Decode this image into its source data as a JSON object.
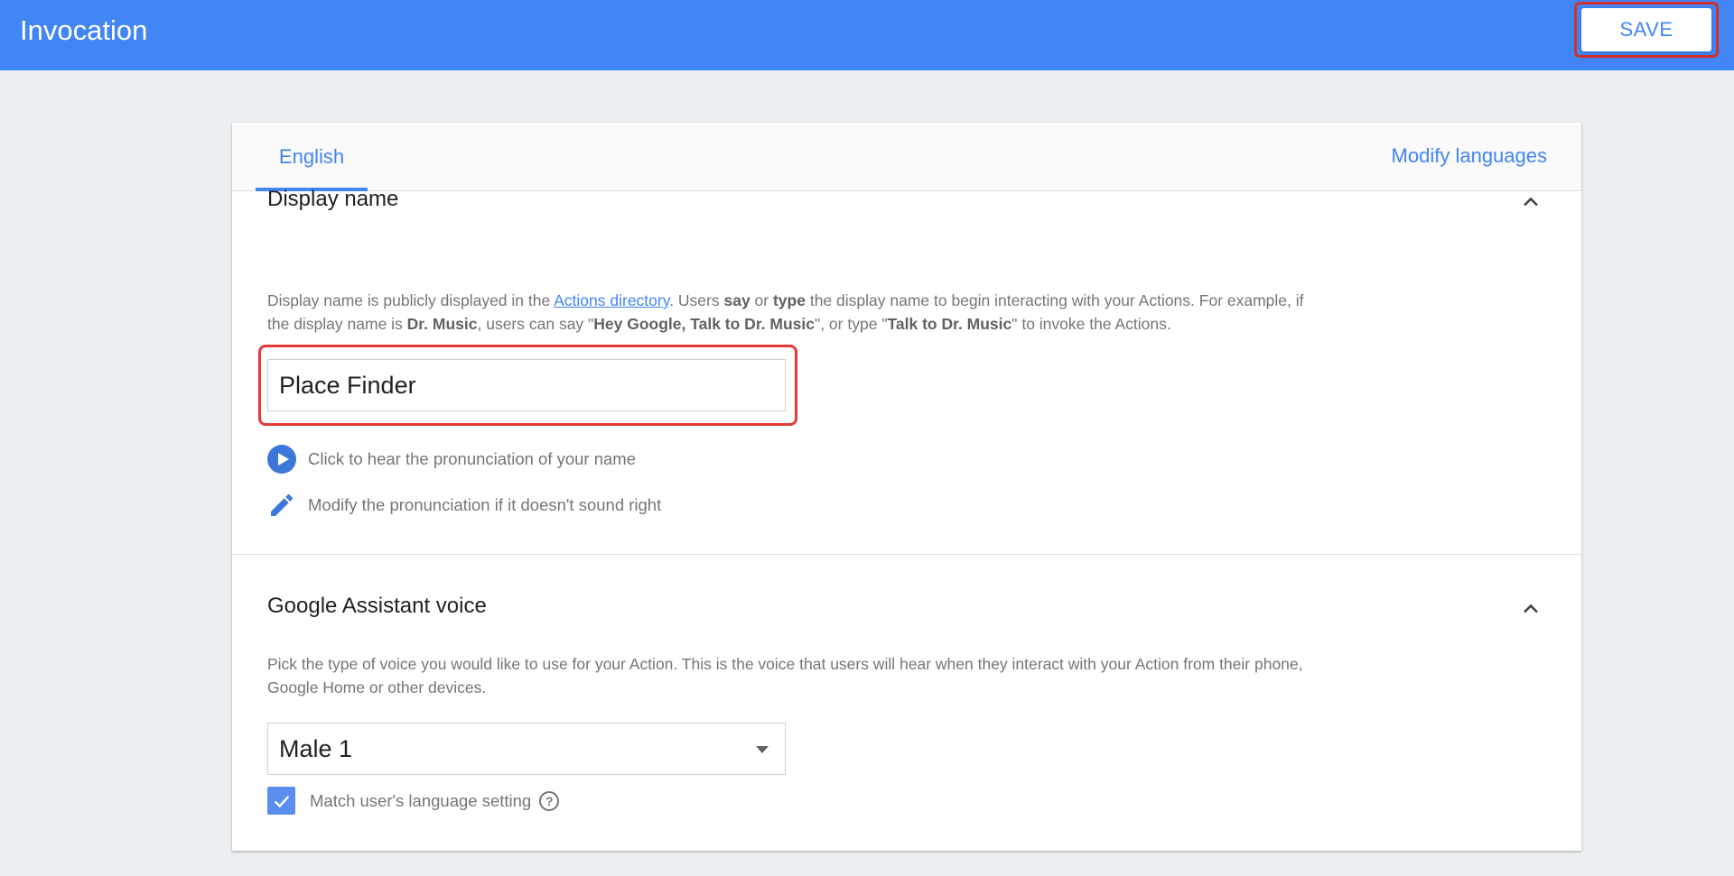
{
  "header": {
    "title": "Invocation",
    "save_label": "SAVE"
  },
  "tabs": {
    "active": "English",
    "modify_languages": "Modify languages"
  },
  "display_name_section": {
    "title": "Display name",
    "desc_1": "Display name is publicly displayed in the ",
    "link": "Actions directory",
    "desc_2": ". Users ",
    "say": "say",
    "or": " or ",
    "type": "type",
    "desc_3": " the display name to begin interacting with your Actions. For example, if the display name is ",
    "example_name": "Dr. Music",
    "desc_4": ", users can say \"",
    "example_phrase": "Hey Google, Talk to Dr. Music",
    "desc_5": "\", or type \"",
    "example_typed": "Talk to Dr. Music",
    "desc_6": "\" to invoke the Actions.",
    "input_value": "Place Finder",
    "hear_label": "Click to hear the pronunciation of your name",
    "modify_label": "Modify the pronunciation if it doesn't sound right"
  },
  "voice_section": {
    "title": "Google Assistant voice",
    "description": "Pick the type of voice you would like to use for your Action. This is the voice that users will hear when they interact with your Action from their phone, Google Home or other devices.",
    "selected_voice": "Male 1",
    "match_language_label": "Match user's language setting",
    "match_language_checked": true,
    "help_glyph": "?"
  },
  "colors": {
    "accent": "#4285f4",
    "highlight": "#e53935"
  }
}
